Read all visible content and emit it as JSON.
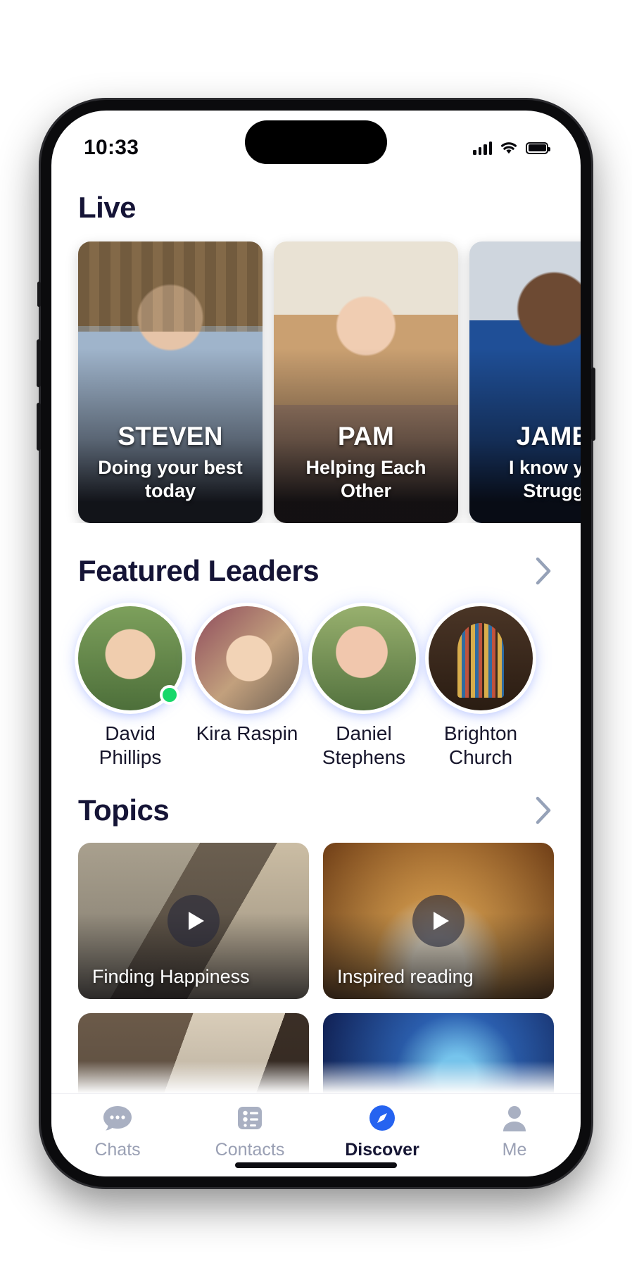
{
  "status_bar": {
    "time": "10:33",
    "signal_icon": "cellular-signal-icon",
    "wifi_icon": "wifi-icon",
    "battery_icon": "battery-full-icon"
  },
  "colors": {
    "heading": "#151436",
    "accent_blue": "#2563f0",
    "online_green": "#18d86a",
    "muted_text": "#9aa0b4",
    "chevron": "#96a2b8"
  },
  "live": {
    "title": "Live",
    "cards": [
      {
        "name": "STEVEN",
        "subtitle": "Doing your best today"
      },
      {
        "name": "PAM",
        "subtitle": "Helping Each Other"
      },
      {
        "name": "JAMES",
        "subtitle": "I know your Struggle"
      }
    ]
  },
  "featured_leaders": {
    "title": "Featured Leaders",
    "chevron_icon": "chevron-right-icon",
    "leaders": [
      {
        "name": "David Phillips",
        "online": true
      },
      {
        "name": "Kira Raspin",
        "online": false
      },
      {
        "name": "Daniel Stephens",
        "online": false
      },
      {
        "name": "Brighton Church",
        "online": false
      }
    ]
  },
  "topics": {
    "title": "Topics",
    "chevron_icon": "chevron-right-icon",
    "cards": [
      {
        "label": "Finding Happiness",
        "play_icon": "play-icon"
      },
      {
        "label": "Inspired reading",
        "play_icon": "play-icon"
      },
      {
        "label": "",
        "play_icon": "play-icon"
      },
      {
        "label": "",
        "play_icon": "play-icon"
      }
    ]
  },
  "tabbar": {
    "tabs": [
      {
        "label": "Chats",
        "icon": "chat-bubble-icon",
        "active": false
      },
      {
        "label": "Contacts",
        "icon": "contacts-list-icon",
        "active": false
      },
      {
        "label": "Discover",
        "icon": "compass-icon",
        "active": true
      },
      {
        "label": "Me",
        "icon": "person-icon",
        "active": false
      }
    ]
  }
}
